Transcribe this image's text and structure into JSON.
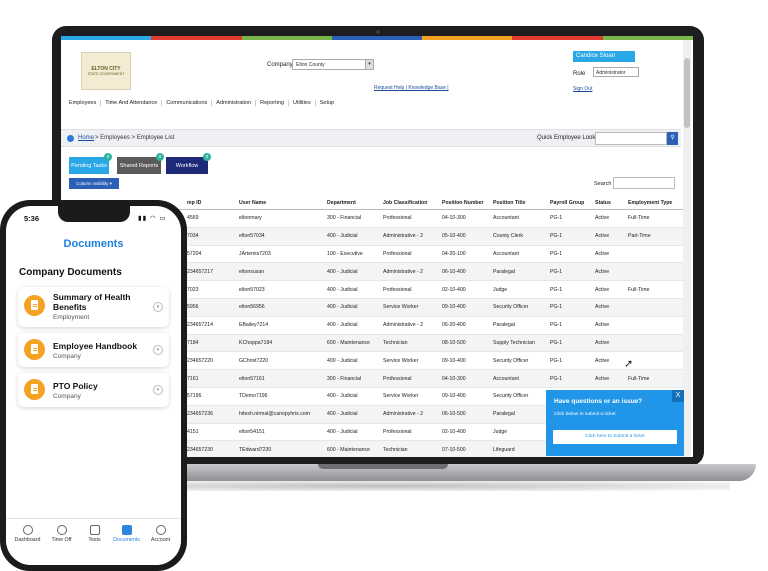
{
  "colors": {
    "accent": "#2aa7e6",
    "navy": "#1e2a78",
    "doc_icon": "#f5a122",
    "phone_accent": "#1f7fe0"
  },
  "top_colorbar": [
    "#2aa7e6",
    "#e03c31",
    "#7ab648",
    "#2b5fb8",
    "#f5a122",
    "#e03c31",
    "#7ab648"
  ],
  "app": {
    "logo": {
      "line1": "ELTON CITY",
      "line2": "STATE GOVERNMENT"
    },
    "company_label": "Company",
    "company_value": "Elton County",
    "help_links": "Request Help | Knowledge Base |",
    "user_name": "Candice Sloan",
    "role_label": "Role",
    "role_value": "Administrator",
    "sign_out": "Sign Out",
    "nav": [
      "Employees",
      "Time And Attendance",
      "Communications",
      "Administration",
      "Reporting",
      "Utilities",
      "Setup"
    ],
    "breadcrumb_home": "Home",
    "breadcrumb_rest": "> Employees > Employee List",
    "lookup_label": "Quick Employee Lookup:",
    "tabs": {
      "pending": "Pending Tasks",
      "pending_count": "0",
      "shared": "Shared Reports",
      "shared_count": "0",
      "workflow": "Workflow",
      "workflow_count": "0"
    },
    "column_visibility": "Column visibility ▾",
    "search_label": "Search",
    "columns": [
      "mp ID",
      "User Name",
      "Department",
      "Job Classification",
      "Position Number",
      "Position Title",
      "Payroll Group",
      "Status",
      "Employment Type"
    ],
    "rows": [
      [
        "4569",
        "eltonmary",
        "300 - Financial",
        "Professional",
        "04-10-300",
        "Accountant",
        "PG-1",
        "Active",
        "Full-Time"
      ],
      [
        "7034",
        "elton57034",
        "400 - Judicial",
        "Administrative - 2",
        "05-10-400",
        "County Clerk",
        "PG-1",
        "Active",
        "Part-Time"
      ],
      [
        "57204",
        "JArtemis7203",
        "100 - Executive",
        "Professional",
        "04-20-100",
        "Accountant",
        "PG-1",
        "Active",
        ""
      ],
      [
        "234657217",
        "eltonsusan",
        "400 - Judicial",
        "Administrative - 2",
        "06-10-400",
        "Paralegal",
        "PG-1",
        "Active",
        ""
      ],
      [
        "7023",
        "elton57023",
        "400 - Judicial",
        "Professional",
        "02-10-400",
        "Judge",
        "PG-1",
        "Active",
        "Full-Time"
      ],
      [
        "5956",
        "elton56956",
        "400 - Judicial",
        "Service Worker",
        "09-10-400",
        "Security Officer",
        "PG-1",
        "Active",
        ""
      ],
      [
        "234657214",
        "EBailey7214",
        "400 - Judicial",
        "Administrative - 2",
        "06-20-400",
        "Paralegal",
        "PG-1",
        "Active",
        ""
      ],
      [
        "7184",
        "KChoppa7184",
        "600 - Maintenance",
        "Technician",
        "08-10-500",
        "Supply Technician",
        "PG-1",
        "Active",
        ""
      ],
      [
        "234657220",
        "GChrist7220",
        "400 - Judicial",
        "Service Worker",
        "09-10-400",
        "Security Officer",
        "PG-1",
        "Active",
        ""
      ],
      [
        "7161",
        "elton57161",
        "300 - Financial",
        "Professional",
        "04-10-300",
        "Accountant",
        "PG-1",
        "Active",
        "Full-Time"
      ],
      [
        "57196",
        "TDemo7196",
        "400 - Judicial",
        "Service Worker",
        "09-10-400",
        "Security Officer",
        "PG-1",
        "Active",
        ""
      ],
      [
        "234657236",
        "hitesh.nirmal@canopyhris.com",
        "400 - Judicial",
        "Administrative - 2",
        "06-10-500",
        "Paralegal",
        "PG-1",
        "Active",
        ""
      ],
      [
        "4151",
        "elton54151",
        "400 - Judicial",
        "Professional",
        "02-10-400",
        "Judge",
        "PG-1",
        "Active",
        ""
      ],
      [
        "234657230",
        "TEdward7230",
        "600 - Maintenance",
        "Technician",
        "07-10-500",
        "Lifeguard",
        "PG-1",
        "Active",
        ""
      ]
    ],
    "help_popup": {
      "title": "Have questions or an issue?",
      "subtitle": "Click below to submit a ticket",
      "button": "Click here to Submit a ticket",
      "close": "X"
    }
  },
  "phone": {
    "time": "5:36",
    "status_icons": "▮▮ ◠ ▭",
    "title": "Documents",
    "section": "Company Documents",
    "docs": [
      {
        "title": "Summary of Health Benefits",
        "subtitle": "Employment"
      },
      {
        "title": "Employee Handbook",
        "subtitle": "Company"
      },
      {
        "title": "PTO Policy",
        "subtitle": "Company"
      }
    ],
    "tabs": [
      "Dashboard",
      "Time Off",
      "Tests",
      "Documents",
      "Account"
    ],
    "active_tab": "Documents"
  }
}
